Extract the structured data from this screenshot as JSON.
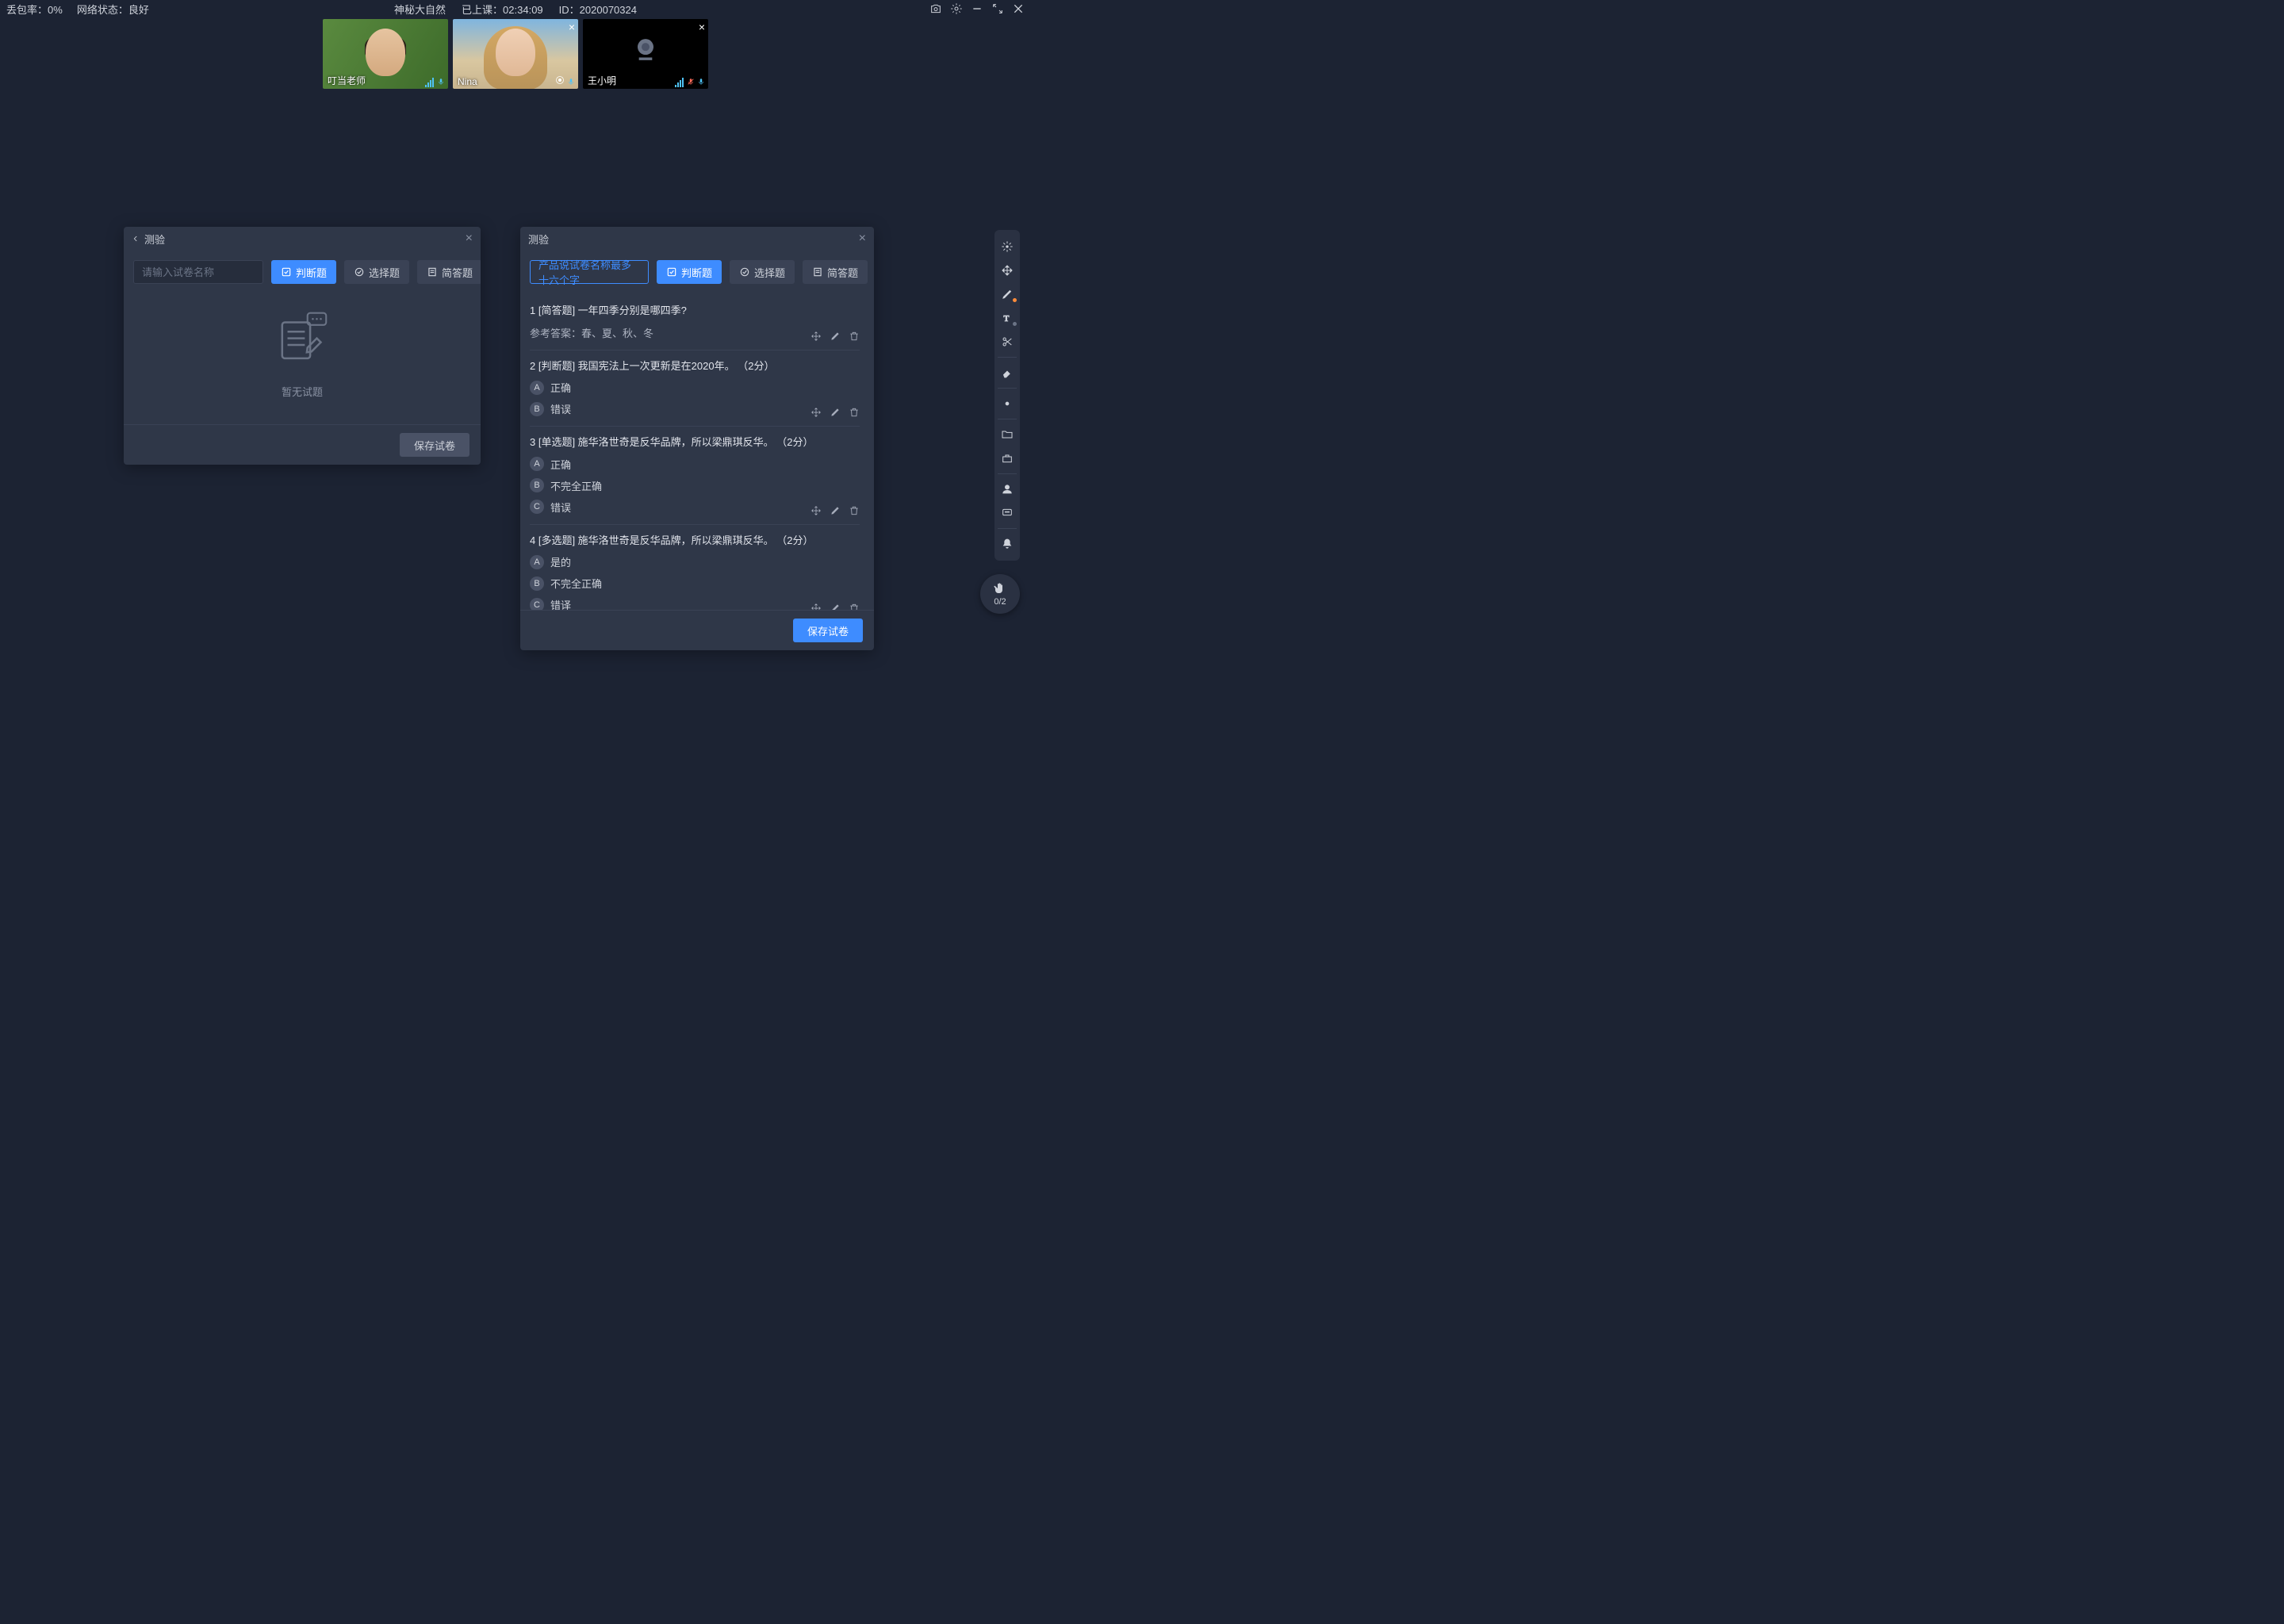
{
  "topbar": {
    "packet_loss_label": "丢包率：",
    "packet_loss_value": "0%",
    "network_label": "网络状态：",
    "network_value": "良好",
    "course_title": "神秘大自然",
    "elapsed_label": "已上课：",
    "elapsed_value": "02:34:09",
    "id_label": "ID：",
    "id_value": "2020070324"
  },
  "videos": [
    {
      "name": "叮当老师",
      "variant": "green",
      "mic": "on",
      "closeable": false
    },
    {
      "name": "Nina",
      "variant": "beach",
      "mic": "on",
      "closeable": true
    },
    {
      "name": "王小明",
      "variant": "black",
      "mic": "muted",
      "closeable": true
    }
  ],
  "hand": {
    "count": "0/2"
  },
  "panels": {
    "left": {
      "title": "测验",
      "placeholder": "请输入试卷名称",
      "type_judge": "判断题",
      "type_choice": "选择题",
      "type_short": "简答题",
      "empty": "暂无试题",
      "save": "保存试卷"
    },
    "right": {
      "title": "测验",
      "name_value": "产品说试卷名称最多十六个字",
      "type_judge": "判断题",
      "type_choice": "选择题",
      "type_short": "简答题",
      "save": "保存试卷",
      "questions": [
        {
          "index": "1",
          "tag": "[简答题]",
          "text": "一年四季分别是哪四季?",
          "answer_label": "参考答案：",
          "answer": "春、夏、秋、冬"
        },
        {
          "index": "2",
          "tag": "[判断题]",
          "text": "我国宪法上一次更新是在2020年。",
          "points": "（2分）",
          "options": [
            {
              "letter": "A",
              "text": "正确"
            },
            {
              "letter": "B",
              "text": "错误"
            }
          ]
        },
        {
          "index": "3",
          "tag": "[单选题]",
          "text": "施华洛世奇是反华品牌，所以梁鼎琪反华。",
          "points": "（2分）",
          "options": [
            {
              "letter": "A",
              "text": "正确"
            },
            {
              "letter": "B",
              "text": "不完全正确"
            },
            {
              "letter": "C",
              "text": "错误"
            }
          ]
        },
        {
          "index": "4",
          "tag": "[多选题]",
          "text": "施华洛世奇是反华品牌，所以梁鼎琪反华。",
          "points": "（2分）",
          "options": [
            {
              "letter": "A",
              "text": "是的"
            },
            {
              "letter": "B",
              "text": "不完全正确"
            },
            {
              "letter": "C",
              "text": "错译"
            }
          ]
        }
      ]
    }
  }
}
